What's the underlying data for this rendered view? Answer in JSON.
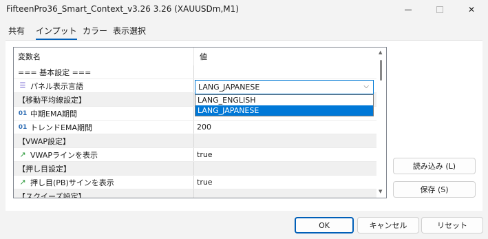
{
  "window": {
    "title": "FifteenPro36_Smart_Context_v3.26 3.26 (XAUUSDm,M1)",
    "minimize": "─",
    "maximize": "",
    "close": "✕"
  },
  "tabs": [
    {
      "label": "共有",
      "active": false
    },
    {
      "label": "インプット",
      "active": true
    },
    {
      "label": "カラー",
      "active": false
    },
    {
      "label": "表示選択",
      "active": false
    }
  ],
  "grid": {
    "header": {
      "name": "変数名",
      "value": "値"
    },
    "rows": [
      {
        "name": "=== 基本設定 ===",
        "value": "",
        "kind": "group-plain",
        "icon": ""
      },
      {
        "name": "パネル表示言語",
        "value": "LANG_JAPANESE",
        "kind": "param",
        "icon": "enum-icon"
      },
      {
        "name": "【移動平均線設定】",
        "value": "",
        "kind": "group",
        "icon": ""
      },
      {
        "name": "中期EMA期間",
        "value": "",
        "kind": "param",
        "icon": "number-icon"
      },
      {
        "name": "トレンドEMA期間",
        "value": "200",
        "kind": "param",
        "icon": "number-icon"
      },
      {
        "name": "【VWAP設定】",
        "value": "",
        "kind": "group",
        "icon": ""
      },
      {
        "name": "VWAPラインを表示",
        "value": "true",
        "kind": "param",
        "icon": "bool-icon"
      },
      {
        "name": "【押し目設定】",
        "value": "",
        "kind": "group",
        "icon": ""
      },
      {
        "name": "押し目(PB)サインを表示",
        "value": "true",
        "kind": "param",
        "icon": "bool-icon"
      },
      {
        "name": "【スクイーズ設定】",
        "value": "",
        "kind": "group",
        "icon": ""
      }
    ],
    "icon_glyphs": {
      "number-icon": "01",
      "bool-icon": "↗",
      "enum-icon": "☰"
    }
  },
  "language_select": {
    "value": "LANG_JAPANESE",
    "chevron": "⌵",
    "options": [
      {
        "label": "LANG_ENGLISH",
        "selected": false
      },
      {
        "label": "LANG_JAPANESE",
        "selected": true
      }
    ]
  },
  "side_buttons": {
    "load": "読み込み (L)",
    "save": "保存 (S)"
  },
  "footer_buttons": {
    "ok": "OK",
    "cancel": "キャンセル",
    "reset": "リセット"
  },
  "colors": {
    "accent": "#005fb8",
    "selection": "#0078d7",
    "group_bg": "#f0f0f0"
  }
}
